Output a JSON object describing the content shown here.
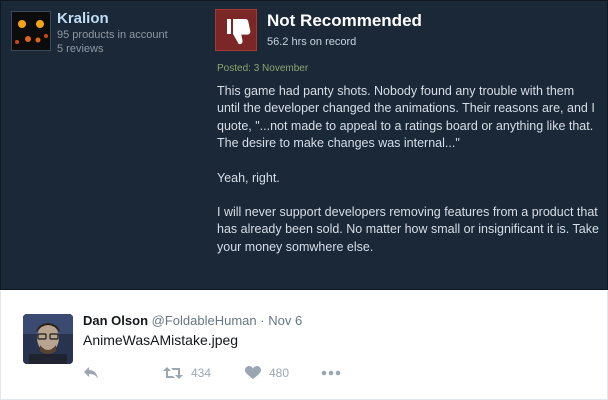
{
  "steam": {
    "user": {
      "name": "Kralion",
      "products": "95 products in account",
      "reviews": "5 reviews"
    },
    "review": {
      "verdict": "Not Recommended",
      "hours": "56.2 hrs on record",
      "posted": "Posted: 3 November",
      "paragraphs": [
        "This game had panty shots. Nobody found any trouble with them until the developer changed the animations. Their reasons are, and I quote, \"...not made to appeal to a ratings board or anything like that. The desire to make changes was internal...\"",
        "Yeah, right.",
        "I will never support developers removing features from a product that has already been sold. No matter how small or insignificant it is. Take your money somwhere else."
      ]
    },
    "colors": {
      "background": "#1b2838",
      "username": "#c1dbf4",
      "thumb_box": "#7a2725",
      "posted": "#8ba66e"
    }
  },
  "tweet": {
    "name": "Dan Olson",
    "handle": "@FoldableHuman",
    "separator": "·",
    "date": "Nov 6",
    "text": "AnimeWasAMistake.jpeg",
    "retweets": "434",
    "likes": "480",
    "icons": [
      "reply-icon",
      "retweet-icon",
      "heart-icon",
      "more-icon"
    ]
  }
}
